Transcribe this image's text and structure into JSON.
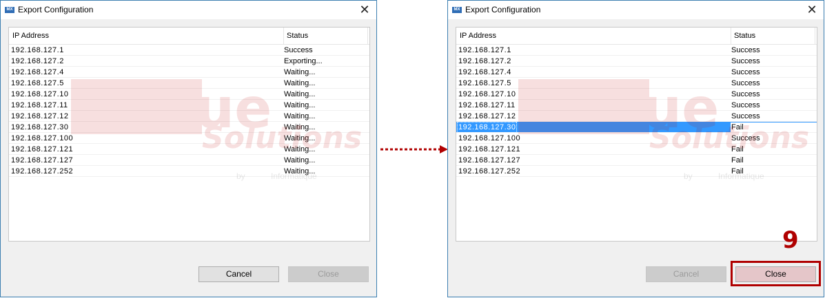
{
  "left_dialog": {
    "title": "Export Configuration",
    "app_icon_text": "MX",
    "close_glyph": "✕",
    "columns": [
      "IP Address",
      "Status"
    ],
    "rows": [
      {
        "ip": "192.168.127.1",
        "status": "Success"
      },
      {
        "ip": "192.168.127.2",
        "status": "Exporting..."
      },
      {
        "ip": "192.168.127.4",
        "status": "Waiting..."
      },
      {
        "ip": "192.168.127.5",
        "status": "Waiting..."
      },
      {
        "ip": "192.168.127.10",
        "status": "Waiting..."
      },
      {
        "ip": "192.168.127.11",
        "status": "Waiting..."
      },
      {
        "ip": "192.168.127.12",
        "status": "Waiting..."
      },
      {
        "ip": "192.168.127.30",
        "status": "Waiting..."
      },
      {
        "ip": "192.168.127.100",
        "status": "Waiting..."
      },
      {
        "ip": "192.168.127.121",
        "status": "Waiting..."
      },
      {
        "ip": "192.168.127.127",
        "status": "Waiting..."
      },
      {
        "ip": "192.168.127.252",
        "status": "Waiting..."
      }
    ],
    "cancel_label": "Cancel",
    "close_label": "Close"
  },
  "right_dialog": {
    "title": "Export Configuration",
    "app_icon_text": "MX",
    "close_glyph": "✕",
    "columns": [
      "IP Address",
      "Status"
    ],
    "selected_row_index": 7,
    "rows": [
      {
        "ip": "192.168.127.1",
        "status": "Success"
      },
      {
        "ip": "192.168.127.2",
        "status": "Success"
      },
      {
        "ip": "192.168.127.4",
        "status": "Success"
      },
      {
        "ip": "192.168.127.5",
        "status": "Success"
      },
      {
        "ip": "192.168.127.10",
        "status": "Success"
      },
      {
        "ip": "192.168.127.11",
        "status": "Success"
      },
      {
        "ip": "192.168.127.12",
        "status": "Success"
      },
      {
        "ip": "192.168.127.30",
        "status": "Fail"
      },
      {
        "ip": "192.168.127.100",
        "status": "Success"
      },
      {
        "ip": "192.168.127.121",
        "status": "Fail"
      },
      {
        "ip": "192.168.127.127",
        "status": "Fail"
      },
      {
        "ip": "192.168.127.252",
        "status": "Fail"
      }
    ],
    "cancel_label": "Cancel",
    "close_label": "Close"
  },
  "watermark": {
    "brand": "PcVue",
    "tagline": "Solutions",
    "by": "by",
    "company": "Informatique"
  },
  "annotation": {
    "step_number": "9",
    "color": "#b00000"
  },
  "colors": {
    "selection": "#3399ff",
    "border": "#3c7fb1",
    "dialog_bg": "#f0f0f0"
  }
}
